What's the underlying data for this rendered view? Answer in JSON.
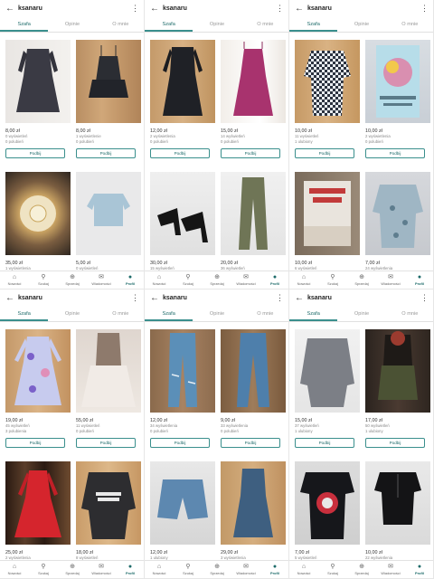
{
  "username": "ksanaru",
  "tabs": [
    "Szafa",
    "Opinie",
    "O mnie"
  ],
  "bottom_nav": [
    {
      "label": "Nowości",
      "icon": "home-icon"
    },
    {
      "label": "Szukaj",
      "icon": "search-icon"
    },
    {
      "label": "Sprzedaj",
      "icon": "plus-circle-icon"
    },
    {
      "label": "Wiadomości",
      "icon": "mail-icon"
    },
    {
      "label": "Profil",
      "icon": "profile-icon"
    }
  ],
  "button_label": "Podbij",
  "colors": {
    "accent": "#3a8f8d",
    "accent_dark": "#1d6b6a"
  },
  "panels": [
    {
      "items": [
        {
          "price": "8,00 zł",
          "views": "0 wyświetleń",
          "likes": "0 polubień",
          "desc": "black lace dress on wood background"
        },
        {
          "price": "8,00 zł",
          "views": "1 wyświetlenie",
          "likes": "0 polubień",
          "desc": "black ruffle top"
        },
        {
          "price": "35,00 zł",
          "views": "1 wyświetlenia",
          "likes": "",
          "desc": "decorative plate"
        },
        {
          "price": "5,00 zł",
          "views": "0 wyświetleń",
          "likes": "",
          "desc": "light blue crop top"
        }
      ]
    },
    {
      "items": [
        {
          "price": "12,00 zł",
          "views": "2 wyświetlenia",
          "likes": "0 polubień",
          "desc": "black dress"
        },
        {
          "price": "15,00 zł",
          "views": "14 wyświetleń",
          "likes": "0 polubień",
          "desc": "pink patterned dress"
        },
        {
          "price": "30,00 zł",
          "views": "15 wyświetleń",
          "likes": "2 polubienia",
          "desc": "black heels"
        },
        {
          "price": "20,00 zł",
          "views": "36 wyświetleń",
          "likes": "3 polubienia",
          "desc": "khaki trousers"
        }
      ]
    },
    {
      "items": [
        {
          "price": "10,00 zł",
          "views": "11 wyświetleń",
          "likes": "1 ulubiony",
          "desc": "checked shirt"
        },
        {
          "price": "10,00 zł",
          "views": "2 wyświetlenia",
          "likes": "0 polubień",
          "desc": "book Pojedynek na słowa"
        },
        {
          "price": "10,00 zł",
          "views": "6 wyświetleń",
          "likes": "0 polubień",
          "desc": "book Koniec wszystkiego"
        },
        {
          "price": "7,00 zł",
          "views": "24 wyświetlenia",
          "likes": "2 polubienia",
          "desc": "floral blouse"
        }
      ]
    },
    {
      "items": [
        {
          "price": "19,00 zł",
          "views": "45 wyświetleń",
          "likes": "3 polubienia",
          "desc": "floral dress"
        },
        {
          "price": "55,00 zł",
          "views": "11 wyświetleń",
          "likes": "0 polubień",
          "desc": "white tulle skirt"
        },
        {
          "price": "25,00 zł",
          "views": "2 wyświetlenia",
          "likes": "",
          "desc": "red skater dress"
        },
        {
          "price": "18,00 zł",
          "views": "8 wyświetleń",
          "likes": "",
          "desc": "Star Wars sweatshirt"
        }
      ]
    },
    {
      "items": [
        {
          "price": "12,00 zł",
          "views": "34 wyświetlenia",
          "likes": "0 polubień",
          "desc": "ripped jeans"
        },
        {
          "price": "9,00 zł",
          "views": "33 wyświetlenia",
          "likes": "0 polubień",
          "desc": "skinny jeans"
        },
        {
          "price": "12,00 zł",
          "views": "1 ulubiony",
          "likes": "",
          "desc": "denim shorts"
        },
        {
          "price": "29,00 zł",
          "views": "3 wyświetlenia",
          "likes": "0 polubień",
          "desc": "denim dress"
        }
      ]
    },
    {
      "items": [
        {
          "price": "15,00 zł",
          "views": "37 wyświetleń",
          "likes": "1 ulubiony",
          "desc": "grey sweater"
        },
        {
          "price": "17,00 zł",
          "views": "50 wyświetleń",
          "likes": "1 ulubiony",
          "desc": "khaki skirt"
        },
        {
          "price": "7,00 zł",
          "views": "5 wyświetleń",
          "likes": "0 polubień",
          "desc": "black printed t-shirt"
        },
        {
          "price": "10,00 zł",
          "views": "22 wyświetlenia",
          "likes": "0 polubień",
          "desc": "black lace-up top"
        }
      ]
    }
  ]
}
